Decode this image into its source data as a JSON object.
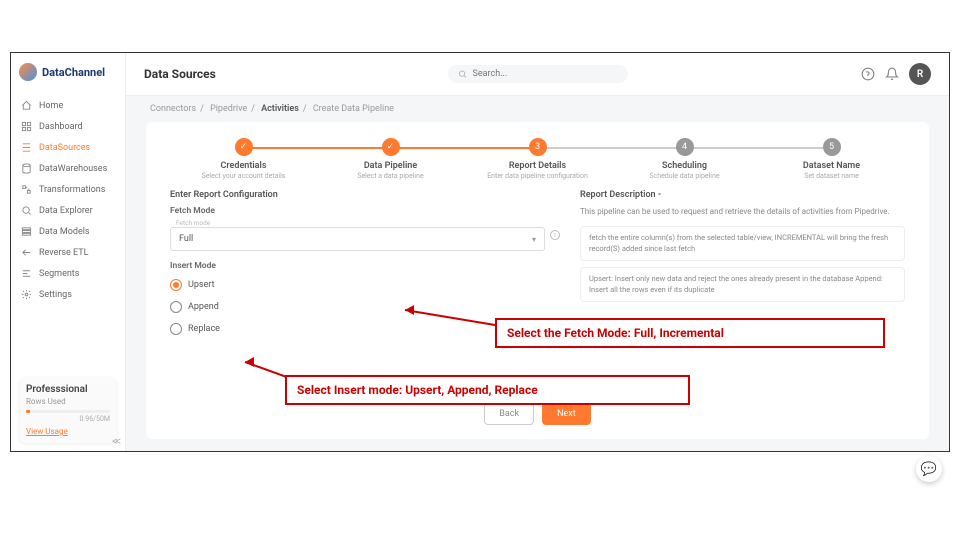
{
  "brand": "DataChannel",
  "header": {
    "title": "Data Sources",
    "search_placeholder": "Search...",
    "avatar_initial": "R"
  },
  "sidebar": {
    "items": [
      {
        "label": "Home"
      },
      {
        "label": "Dashboard"
      },
      {
        "label": "DataSources"
      },
      {
        "label": "DataWarehouses"
      },
      {
        "label": "Transformations"
      },
      {
        "label": "Data Explorer"
      },
      {
        "label": "Data Models"
      },
      {
        "label": "Reverse ETL"
      },
      {
        "label": "Segments"
      },
      {
        "label": "Settings"
      }
    ],
    "plan": {
      "tier": "Professsional",
      "rows_label": "Rows Used",
      "usage": "0.96/50M",
      "view": "View Usage"
    }
  },
  "breadcrumbs": [
    "Connectors",
    "Pipedrive",
    "Activities",
    "Create Data Pipeline"
  ],
  "stepper": [
    {
      "title": "Credentials",
      "sub": "Select your account details",
      "state": "done",
      "num": "✓"
    },
    {
      "title": "Data Pipeline",
      "sub": "Select a data pipeline",
      "state": "done",
      "num": "✓"
    },
    {
      "title": "Report Details",
      "sub": "Enter data pipeline configuration",
      "state": "current",
      "num": "3"
    },
    {
      "title": "Scheduling",
      "sub": "Schedule data pipeline",
      "state": "pending",
      "num": "4"
    },
    {
      "title": "Dataset Name",
      "sub": "Set dataset name",
      "state": "pending",
      "num": "5"
    }
  ],
  "form": {
    "section_title": "Enter Report Configuration",
    "fetch_label": "Fetch Mode",
    "fetch_hint": "Fetch mode",
    "fetch_value": "Full",
    "insert_label": "Insert Mode",
    "insert_options": [
      "Upsert",
      "Append",
      "Replace"
    ],
    "insert_selected": "Upsert"
  },
  "report": {
    "heading": "Report Description -",
    "summary": "This pipeline can be used to request and retrieve the details of activities from Pipedrive.",
    "box1": "fetch the entire column(s) from the selected table/view, INCREMENTAL will bring the fresh record(S) added since last fetch",
    "box2": "Upsert: Insert only new data and reject the ones already present in the database Append: Insert all the rows even if its duplicate"
  },
  "buttons": {
    "back": "Back",
    "next": "Next"
  },
  "annotations": {
    "fetch": "Select the Fetch Mode: Full, Incremental",
    "insert": "Select Insert mode: Upsert, Append, Replace"
  }
}
